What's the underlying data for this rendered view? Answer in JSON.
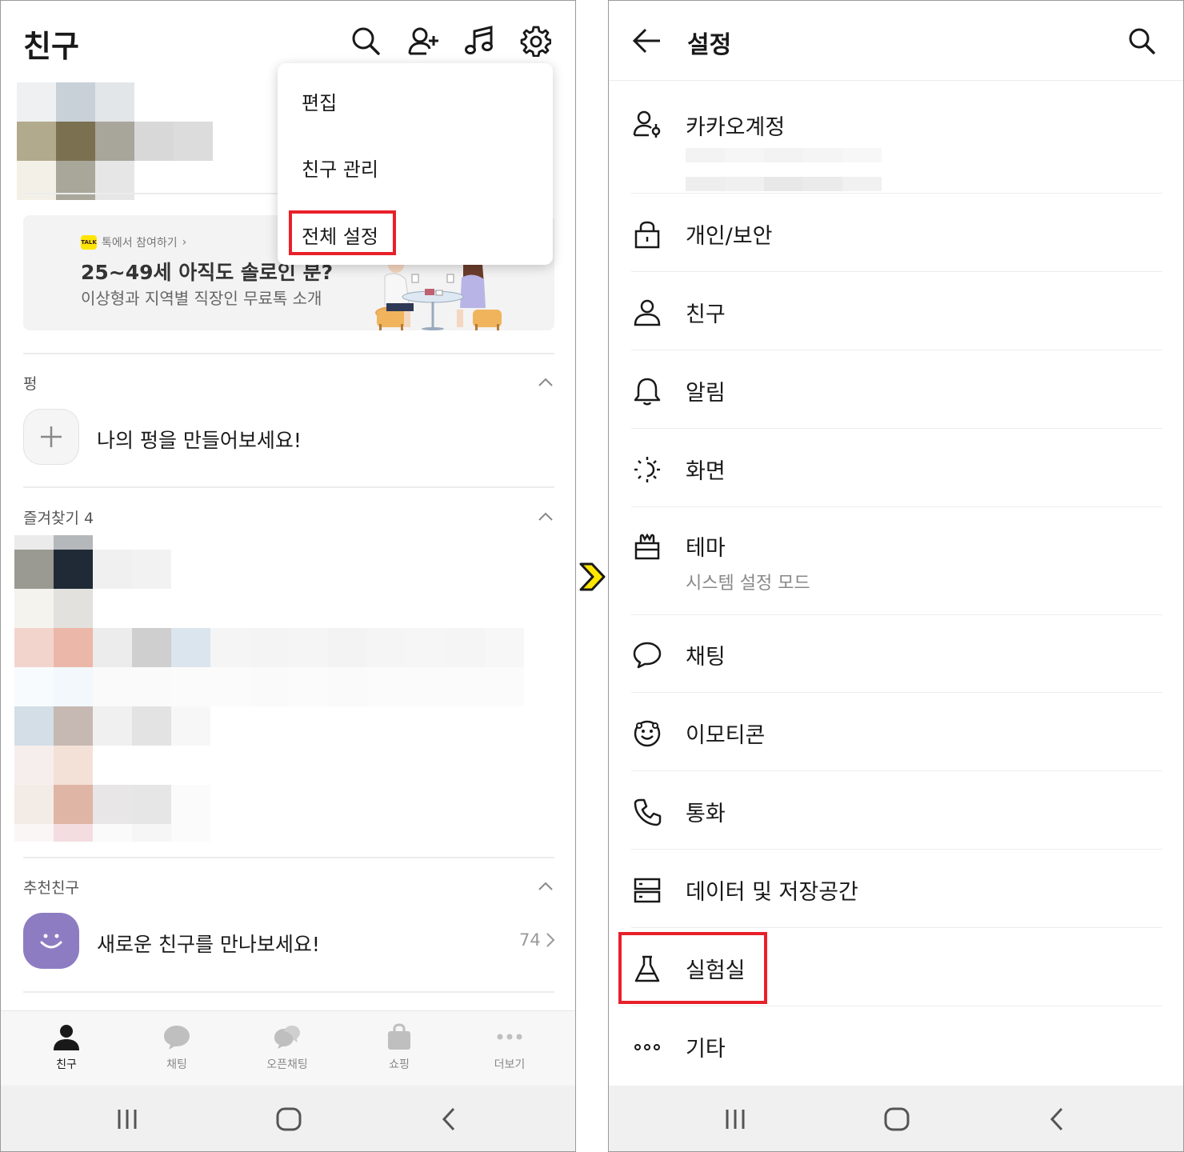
{
  "friends_screen": {
    "title": "친구",
    "header_icons": [
      "search-icon",
      "add-friend-icon",
      "music-icon",
      "gear-icon"
    ],
    "menu": {
      "items": [
        "편집",
        "친구 관리",
        "전체 설정"
      ],
      "highlighted_index": 2
    },
    "banner": {
      "tag": "TALK",
      "link": "톡에서 참여하기",
      "title": "25~49세 아직도 솔로인 분?",
      "subtitle": "이상형과 지역별 직장인 무료톡 소개"
    },
    "sections": {
      "pyeong": {
        "label": "펑",
        "action_text": "나의 펑을 만들어보세요!"
      },
      "favorites": {
        "label": "즐겨찾기 4"
      },
      "recommended": {
        "label": "추천친구",
        "action_text": "새로운 친구를 만나보세요!",
        "count": "74"
      }
    },
    "tabs": [
      {
        "label": "친구",
        "icon": "person-icon",
        "active": true
      },
      {
        "label": "채팅",
        "icon": "chat-icon",
        "active": false
      },
      {
        "label": "오픈채팅",
        "icon": "open-chat-icon",
        "active": false
      },
      {
        "label": "쇼핑",
        "icon": "shopping-bag-icon",
        "active": false
      },
      {
        "label": "더보기",
        "icon": "more-icon",
        "active": false
      }
    ]
  },
  "settings_screen": {
    "title": "설정",
    "items": [
      {
        "label": "카카오계정",
        "icon": "account-icon"
      },
      {
        "label": "개인/보안",
        "icon": "lock-icon"
      },
      {
        "label": "친구",
        "icon": "person-icon"
      },
      {
        "label": "알림",
        "icon": "bell-icon"
      },
      {
        "label": "화면",
        "icon": "brightness-icon"
      },
      {
        "label": "테마",
        "icon": "theme-icon",
        "sub": "시스템 설정 모드"
      },
      {
        "label": "채팅",
        "icon": "chat-bubble-icon"
      },
      {
        "label": "이모티콘",
        "icon": "emoticon-icon"
      },
      {
        "label": "통화",
        "icon": "phone-icon"
      },
      {
        "label": "데이터 및 저장공간",
        "icon": "storage-icon"
      },
      {
        "label": "실험실",
        "icon": "flask-icon"
      },
      {
        "label": "기타",
        "icon": "more-dots-icon"
      }
    ],
    "highlighted_item": "실험실"
  },
  "colors": {
    "highlight": "#e8202a",
    "kakao_yellow": "#fee500",
    "recommend_avatar": "#8e7cc3",
    "arrow_yellow": "#ffe600"
  }
}
